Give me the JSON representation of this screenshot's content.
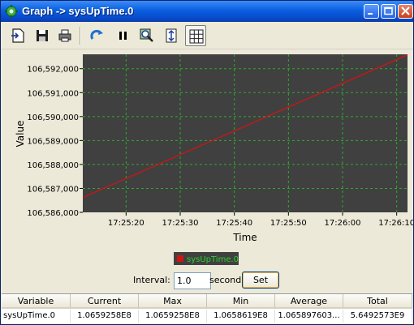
{
  "window": {
    "title": "Graph -> sysUpTime.0"
  },
  "toolbar": {
    "items": [
      "export-icon",
      "save-icon",
      "print-icon",
      "refresh-icon",
      "pause-icon",
      "zoom-icon",
      "fit-icon",
      "grid-icon"
    ]
  },
  "chart_data": {
    "type": "line",
    "xlabel": "Time",
    "ylabel": "Value",
    "x_ticks": [
      "17:25:20",
      "17:25:30",
      "17:25:40",
      "17:25:50",
      "17:26:00",
      "17:26:10"
    ],
    "y_ticks": [
      "106,586,000",
      "106,587,000",
      "106,588,000",
      "106,589,000",
      "106,590,000",
      "106,591,000",
      "106,592,000"
    ],
    "ylim": [
      106586000,
      106592600
    ],
    "xlim": [
      "17:25:12",
      "17:26:12"
    ],
    "series": [
      {
        "name": "sysUpTime.0",
        "color": "#d01414",
        "x": [
          "17:25:12",
          "17:26:12"
        ],
        "y": [
          106586619,
          106592580
        ]
      }
    ],
    "grid": true,
    "plot_background": "#404040",
    "grid_color": "#2fa92f",
    "legend": "bottom-center"
  },
  "interval": {
    "label": "Interval:",
    "value": "1.0",
    "unit": "second",
    "set_label": "Set"
  },
  "stats_table": {
    "headers": [
      "Variable",
      "Current",
      "Max",
      "Min",
      "Average",
      "Total"
    ],
    "row": [
      "sysUpTime.0",
      "1.0659258E8",
      "1.0659258E8",
      "1.0658619E8",
      "1.065897603...",
      "5.6492573E9"
    ]
  }
}
